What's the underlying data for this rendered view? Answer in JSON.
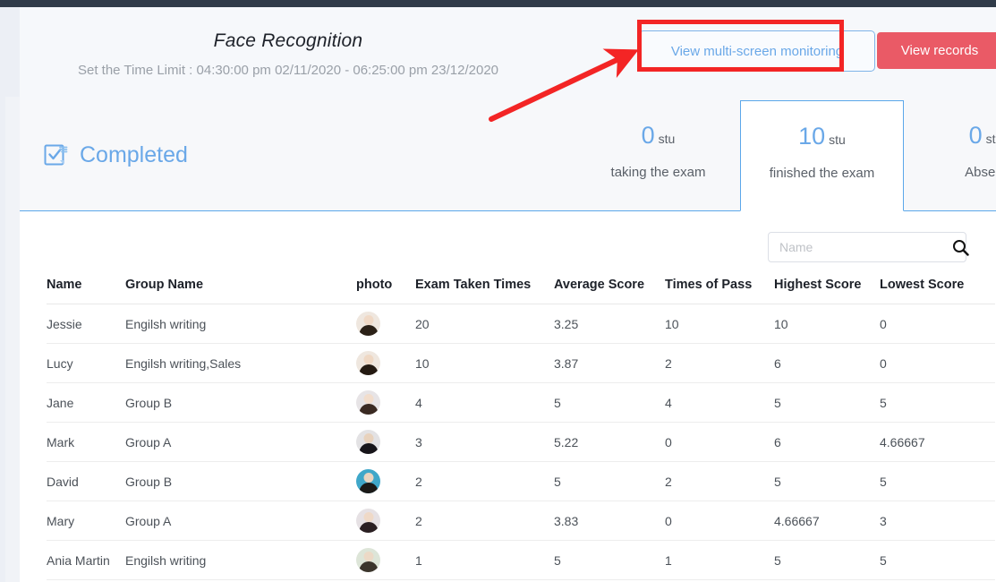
{
  "header": {
    "title": "Face Recognition",
    "subtitle": "Set the Time Limit : 04:30:00 pm 02/11/2020 - 06:25:00 pm 23/12/2020",
    "view_monitoring_label": "View multi-screen monitoring",
    "view_records_label": "View records"
  },
  "status": {
    "label": "Completed",
    "icon": "checked-document-icon"
  },
  "stats": [
    {
      "count": "0",
      "unit": "stu",
      "caption": "taking the exam",
      "active": false
    },
    {
      "count": "10",
      "unit": "stu",
      "caption": "finished the exam",
      "active": true
    },
    {
      "count": "0",
      "unit": "stu",
      "caption": "Absent",
      "active": false
    }
  ],
  "search": {
    "placeholder": "Name",
    "value": "",
    "icon": "search-icon"
  },
  "table": {
    "columns": [
      "Name",
      "Group Name",
      "photo",
      "Exam Taken Times",
      "Average Score",
      "Times of Pass",
      "Highest Score",
      "Lowest Score"
    ],
    "rows": [
      {
        "name": "Jessie",
        "group": "Engilsh writing",
        "photo": "portrait-avatar",
        "taken": "20",
        "average": "3.25",
        "pass": "10",
        "highest": "10",
        "lowest": "0"
      },
      {
        "name": "Lucy",
        "group": "Engilsh writing,Sales",
        "photo": "portrait-avatar",
        "taken": "10",
        "average": "3.87",
        "pass": "2",
        "highest": "6",
        "lowest": "0"
      },
      {
        "name": "Jane",
        "group": "Group B",
        "photo": "portrait-avatar",
        "taken": "4",
        "average": "5",
        "pass": "4",
        "highest": "5",
        "lowest": "5"
      },
      {
        "name": "Mark",
        "group": "Group A",
        "photo": "portrait-avatar",
        "taken": "3",
        "average": "5.22",
        "pass": "0",
        "highest": "6",
        "lowest": "4.66667"
      },
      {
        "name": "David",
        "group": "Group B",
        "photo": "portrait-avatar",
        "taken": "2",
        "average": "5",
        "pass": "2",
        "highest": "5",
        "lowest": "5"
      },
      {
        "name": "Mary",
        "group": "Group A",
        "photo": "portrait-avatar",
        "taken": "2",
        "average": "3.83",
        "pass": "0",
        "highest": "4.66667",
        "lowest": "3"
      },
      {
        "name": "Ania Martin",
        "group": "Engilsh writing",
        "photo": "portrait-avatar",
        "taken": "1",
        "average": "5",
        "pass": "1",
        "highest": "5",
        "lowest": "5"
      }
    ]
  },
  "annotation": {
    "highlight_target": "view-multi-screen-monitoring-button",
    "box_color": "#f32525",
    "arrow_color": "#f32525"
  },
  "colors": {
    "accent_blue": "#6aa8e8",
    "border_blue": "#5ba7ea",
    "danger_red": "#ea5a66",
    "page_bg": "#f4f6fa",
    "topbar": "#303b49"
  }
}
